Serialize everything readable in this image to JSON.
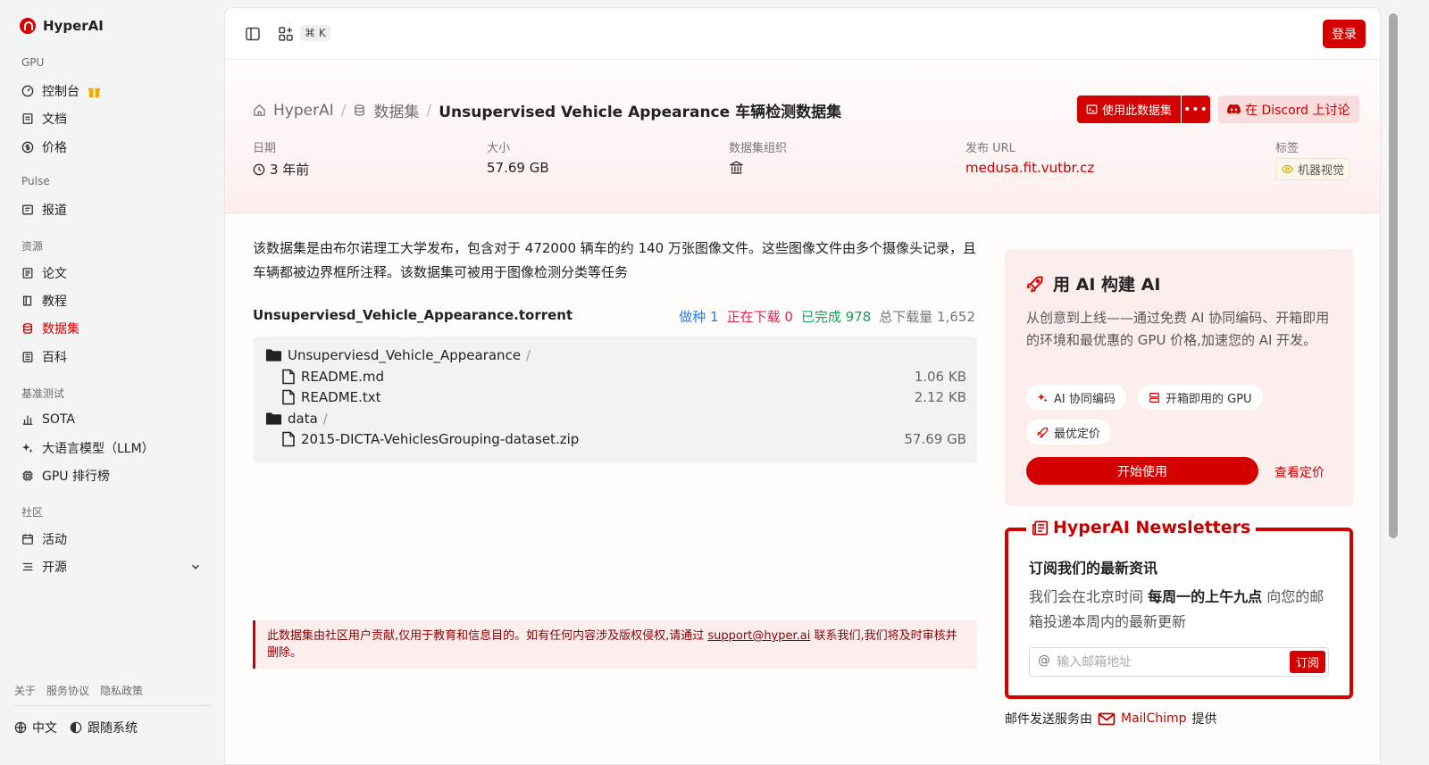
{
  "app": {
    "name": "HyperAI"
  },
  "sidebar": {
    "groups": [
      {
        "label": "GPU",
        "items": [
          {
            "label": "控制台",
            "icon": "dashboard-icon"
          },
          {
            "label": "文档",
            "icon": "document-icon"
          },
          {
            "label": "价格",
            "icon": "dollar-icon"
          }
        ]
      },
      {
        "label": "Pulse",
        "items": [
          {
            "label": "报道",
            "icon": "news-icon"
          }
        ]
      },
      {
        "label": "资源",
        "items": [
          {
            "label": "论文",
            "icon": "paper-icon"
          },
          {
            "label": "教程",
            "icon": "book-icon"
          },
          {
            "label": "数据集",
            "icon": "database-icon",
            "active": true
          },
          {
            "label": "百科",
            "icon": "wiki-icon"
          }
        ]
      },
      {
        "label": "基准测试",
        "items": [
          {
            "label": "SOTA",
            "icon": "bar-chart-icon"
          },
          {
            "label": "大语言模型（LLM）",
            "icon": "sparkle-icon"
          },
          {
            "label": "GPU 排行榜",
            "icon": "chip-icon"
          }
        ]
      },
      {
        "label": "社区",
        "items": [
          {
            "label": "活动",
            "icon": "calendar-icon"
          },
          {
            "label": "开源",
            "icon": "list-icon"
          }
        ]
      }
    ],
    "footer_links": [
      "关于",
      "服务协议",
      "隐私政策"
    ],
    "language": "中文",
    "theme": "跟随系统"
  },
  "topbar": {
    "shortcut": "⌘ K",
    "login_label": "登录"
  },
  "breadcrumb": {
    "home": "HyperAI",
    "section": "数据集",
    "current": "Unsupervised Vehicle Appearance 车辆检测数据集"
  },
  "actions": {
    "use_dataset": "使用此数据集",
    "more": "•••",
    "discord": "在 Discord 上讨论"
  },
  "meta": {
    "date_label": "日期",
    "date_value": "3 年前",
    "size_label": "大小",
    "size_value": "57.69 GB",
    "org_label": "数据集组织",
    "url_label": "发布 URL",
    "url_value": "medusa.fit.vutbr.cz",
    "tags_label": "标签",
    "tag": "机器视觉"
  },
  "description": "该数据集是由布尔诺理工大学发布，包含对于 472000 辆车的约 140 万张图像文件。这些图像文件由多个摄像头记录，且车辆都被边界框所注释。该数据集可被用于图像检测分类等任务",
  "torrent": {
    "name": "Unsuperviesd_Vehicle_Appearance.torrent",
    "seeding": "做种 1",
    "downloading": "正在下载 0",
    "completed": "已完成 978",
    "total": "总下载量 1,652",
    "folder1": "Unsuperviesd_Vehicle_Appearance",
    "file1": {
      "name": "README.md",
      "size": "1.06 KB"
    },
    "file2": {
      "name": "README.txt",
      "size": "2.12 KB"
    },
    "folder2": "data",
    "file3": {
      "name": "2015-DICTA-VehiclesGrouping-dataset.zip",
      "size": "57.69 GB"
    },
    "slash": "/"
  },
  "disclaimer": {
    "before": "此数据集由社区用户贡献,仅用于教育和信息目的。如有任何内容涉及版权侵权,请通过 ",
    "email": "support@hyper.ai",
    "after": " 联系我们,我们将及时审核并删除。"
  },
  "ai_card": {
    "title": "用 AI 构建 AI",
    "desc": "从创意到上线——通过免费 AI 协同编码、开箱即用的环境和最优惠的 GPU 价格,加速您的 AI 开发。",
    "chips": [
      "AI 协同编码",
      "开箱即用的 GPU",
      "最优定价"
    ],
    "start": "开始使用",
    "pricing": "查看定价"
  },
  "newsletter": {
    "title": "HyperAI Newsletters",
    "subtitle": "订阅我们的最新资讯",
    "desc_pre": "我们会在北京时间 ",
    "desc_bold": "每周一的上午九点",
    "desc_post": " 向您的邮箱投递本周内的最新更新",
    "placeholder": "输入邮箱地址",
    "subscribe": "订阅",
    "provided_pre": "邮件发送服务由",
    "provider": "MailChimp",
    "provided_post": "提供"
  },
  "colors": {
    "accent": "#d40000",
    "seeding": "#2f7be0",
    "downloading": "#e0284b",
    "completed": "#18a058"
  }
}
